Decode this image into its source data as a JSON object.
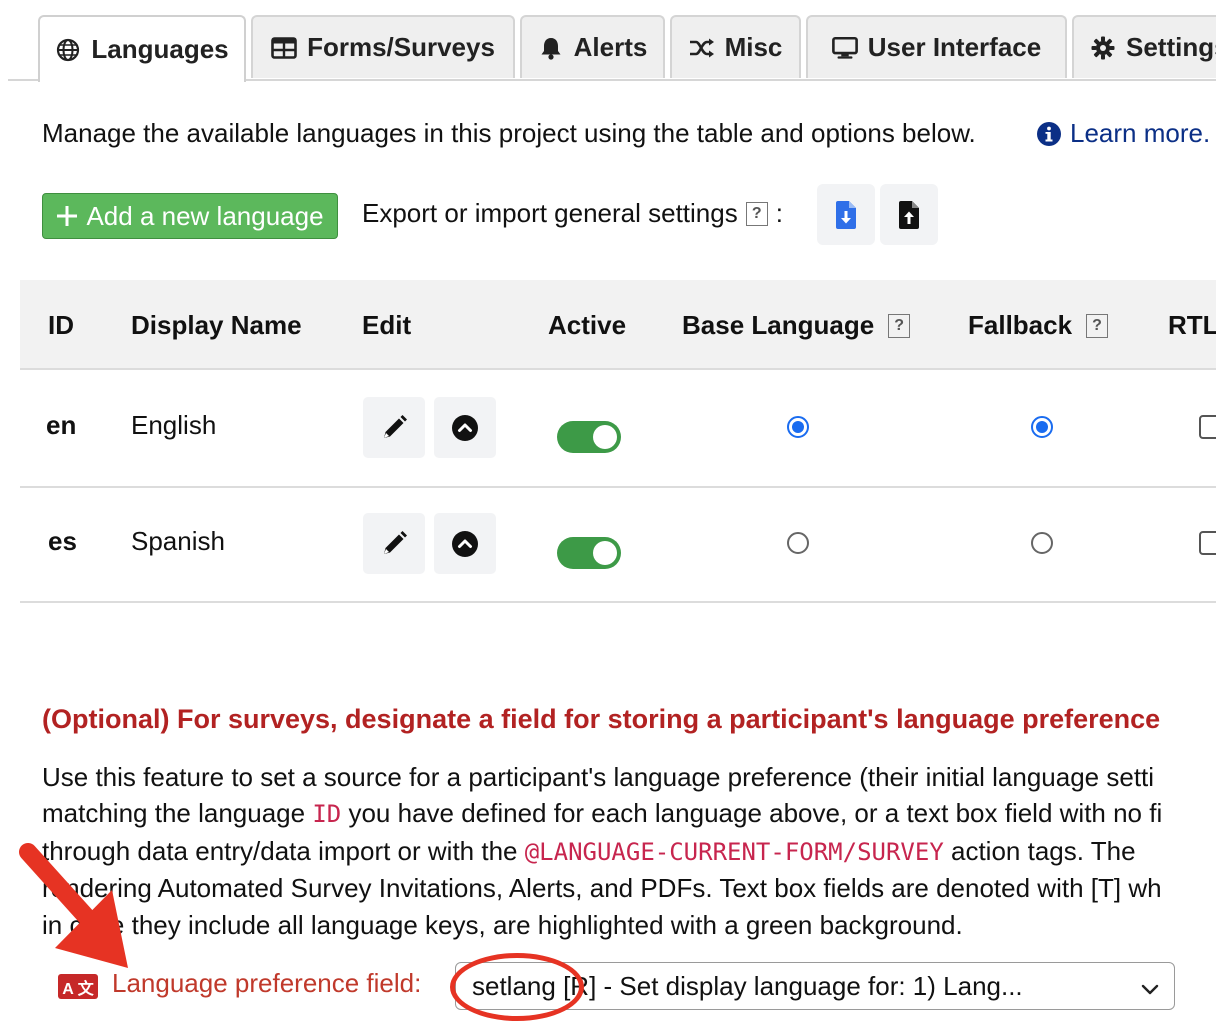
{
  "tabs": [
    {
      "label": "Languages",
      "icon": "globe-icon",
      "active": true
    },
    {
      "label": "Forms/Surveys",
      "icon": "table-icon",
      "active": false
    },
    {
      "label": "Alerts",
      "icon": "bell-icon",
      "active": false
    },
    {
      "label": "Misc",
      "icon": "shuffle-icon",
      "active": false
    },
    {
      "label": "User Interface",
      "icon": "desktop-icon",
      "active": false
    },
    {
      "label": "Settings",
      "icon": "gear-icon",
      "active": false
    }
  ],
  "intro": {
    "text": "Manage the available languages in this project using the table and options below.",
    "learn_more": "Learn more."
  },
  "toolbar": {
    "add_language": "Add a new language",
    "export_import": "Export or import general settings",
    "help_mark": "?",
    "colon": ":"
  },
  "table": {
    "headers": {
      "id": "ID",
      "display_name": "Display Name",
      "edit": "Edit",
      "active": "Active",
      "base_language": "Base Language",
      "fallback": "Fallback",
      "rtl": "RTL"
    },
    "rows": [
      {
        "id": "en",
        "name": "English",
        "active": true,
        "base": true,
        "fallback": true,
        "rtl": false
      },
      {
        "id": "es",
        "name": "Spanish",
        "active": true,
        "base": false,
        "fallback": false,
        "rtl": false
      }
    ]
  },
  "optional": {
    "title": "(Optional) For surveys, designate a field for storing a participant's language preference",
    "line1": "Use this feature to set a source for a participant's language preference (their initial language setti",
    "line2_a": "matching the language",
    "line2_code": "ID",
    "line2_b": "you have defined for each language above, or a text box field with no fi",
    "line3_a": "through data entry/data import or with the",
    "line3_code": "@LANGUAGE-CURRENT-FORM/SURVEY",
    "line3_b": "action tags. The",
    "line4": "rendering Automated Survey Invitations, Alerts, and PDFs. Text box fields are denoted with [T] wh",
    "line5": "in case they include all language keys, are highlighted with a green background."
  },
  "preference": {
    "label": "Language preference field:",
    "icon_text": "A 文",
    "selected": "setlang [R] -   Set display language for: 1) Lang..."
  },
  "colors": {
    "accent_green": "#5cb85c",
    "toggle_green": "#3d9a47",
    "radio_blue": "#1a6cf0",
    "warning_red": "#b22222",
    "annotation_red": "#e63323",
    "link_blue": "#0b2f86"
  }
}
